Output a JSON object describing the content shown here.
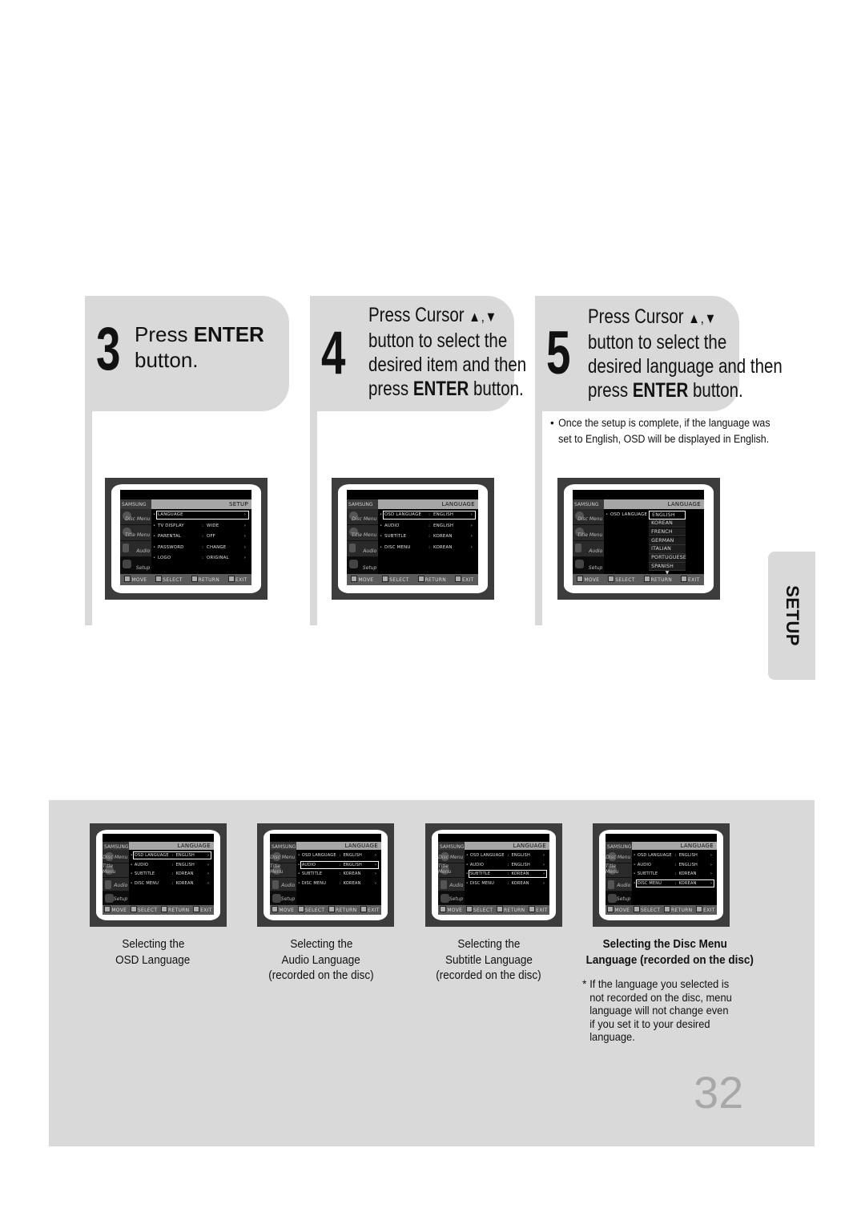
{
  "steps": [
    {
      "number": "3",
      "lines": [
        {
          "pre": "Press ",
          "bold": "ENTER",
          "post": ""
        },
        {
          "pre": "button.",
          "bold": "",
          "post": ""
        }
      ]
    },
    {
      "number": "4",
      "lines": [
        {
          "pre": "Press Cursor ",
          "bold": "",
          "post": "",
          "arrows": "▲,▼"
        },
        {
          "pre": "button to select the",
          "bold": "",
          "post": ""
        },
        {
          "pre": "desired item and then",
          "bold": "",
          "post": ""
        },
        {
          "pre": "press ",
          "bold": "ENTER",
          "post": " button."
        }
      ]
    },
    {
      "number": "5",
      "lines": [
        {
          "pre": "Press Cursor ",
          "bold": "",
          "post": "",
          "arrows": "▲,▼"
        },
        {
          "pre": "button to select the",
          "bold": "",
          "post": ""
        },
        {
          "pre": "desired language and then",
          "bold": "",
          "post": ""
        },
        {
          "pre": "press ",
          "bold": "ENTER",
          "post": " button."
        }
      ],
      "note": {
        "bullet": "•",
        "lines": [
          "Once the setup is complete, if the language was",
          "set to English, OSD will be displayed in English."
        ]
      }
    }
  ],
  "osd": {
    "brand": "SAMSUNG",
    "sidebar": [
      "Disc Menu",
      "Title Menu",
      "Audio",
      "Setup"
    ],
    "footer": [
      "MOVE",
      "SELECT",
      "RETURN",
      "EXIT"
    ],
    "colon": ":",
    "arrow": "›",
    "bullet": "•",
    "setup_screen": {
      "title": "SETUP",
      "rows": [
        {
          "key": "LANGUAGE",
          "value": "",
          "selected": true
        },
        {
          "key": "TV DISPLAY",
          "value": "WIDE",
          "selected": false
        },
        {
          "key": "PARENTAL",
          "value": "OFF",
          "selected": false
        },
        {
          "key": "PASSWORD",
          "value": "CHANGE",
          "selected": false
        },
        {
          "key": "LOGO",
          "value": "ORIGINAL",
          "selected": false
        }
      ]
    },
    "language_screen": {
      "title": "LANGUAGE",
      "rows": [
        {
          "key": "OSD LANGUAGE",
          "value": "ENGLISH"
        },
        {
          "key": "AUDIO",
          "value": "ENGLISH"
        },
        {
          "key": "SUBTITLE",
          "value": "KOREAN"
        },
        {
          "key": "DISC MENU",
          "value": "KOREAN"
        }
      ]
    },
    "dropdown_screen": {
      "title": "LANGUAGE",
      "label": "OSD LANGUAGE",
      "options": [
        "ENGLISH",
        "KOREAN",
        "FRENCH",
        "GERMAN",
        "ITALIAN",
        "PORTUGUESE",
        "SPANISH"
      ],
      "selected_index": 0,
      "more_indicator": "▼"
    }
  },
  "side_tab": {
    "label": "SETUP"
  },
  "bottom": {
    "captions": [
      {
        "lines": [
          "Selecting the",
          "OSD Language"
        ],
        "bold": false,
        "selected_row": 0
      },
      {
        "lines": [
          "Selecting the",
          "Audio Language",
          "(recorded on the disc)"
        ],
        "bold": false,
        "selected_row": 1
      },
      {
        "lines": [
          "Selecting the",
          "Subtitle Language",
          "(recorded on the disc)"
        ],
        "bold": false,
        "selected_row": 2
      },
      {
        "lines": [
          "Selecting the Disc Menu",
          "Language (recorded on the disc)"
        ],
        "bold": true,
        "selected_row": 3
      }
    ],
    "footnote": {
      "star": "*",
      "lines": [
        "If the language you selected is",
        "not recorded on the disc, menu",
        "language will not change even",
        "if you set it to your desired",
        "language."
      ]
    }
  },
  "page_number": "32"
}
